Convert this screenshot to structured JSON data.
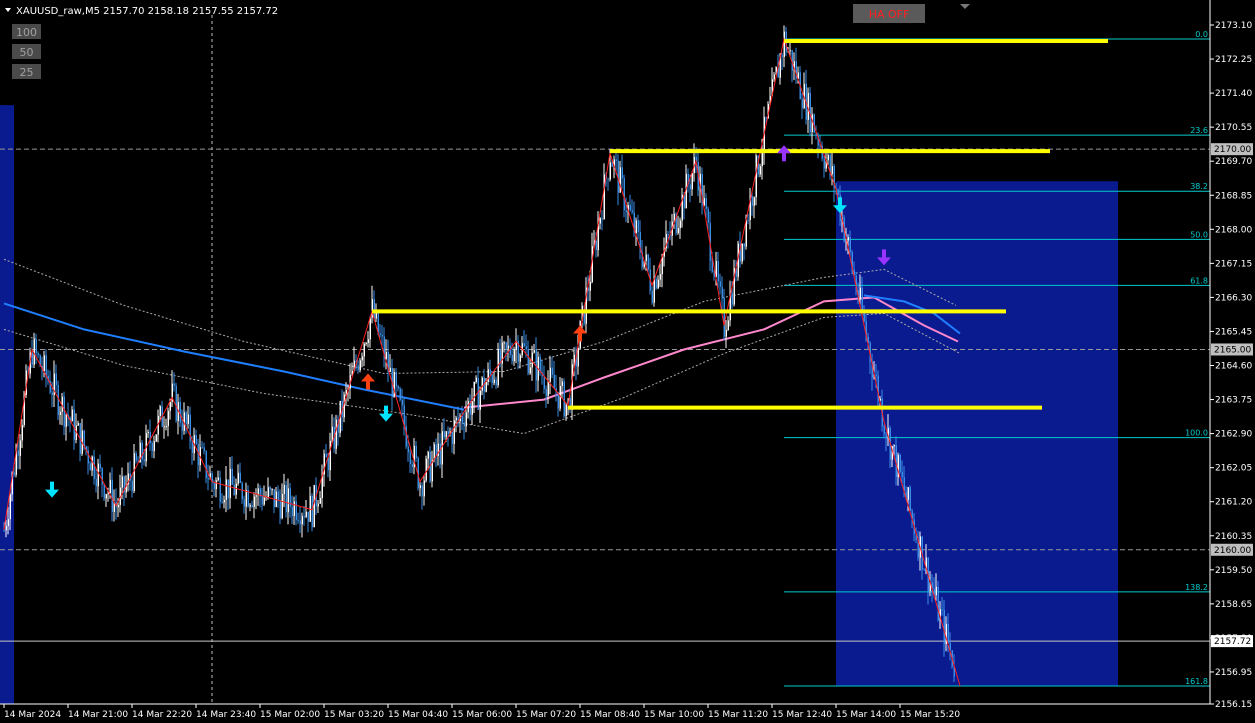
{
  "header": {
    "title": "XAUUSD_raw,M5  2157.70 2158.18 2157.55 2157.72"
  },
  "buttons": {
    "scale": [
      "100",
      "50",
      "25"
    ],
    "ha_toggle": "HA OFF"
  },
  "colors": {
    "background": "#000000",
    "bull_candle": "#ffffff",
    "bear_candle": "#3a8ee6",
    "zigzag": "#ff2020",
    "level": "#ffff00",
    "fib": "#00cccc",
    "ma_blue": "#1f7fff",
    "ma_pink": "#ff88cc",
    "arrow_up": "#ff4010",
    "arrow_down_cyan": "#00e5ff",
    "arrow_purple": "#9933ff",
    "box": "#0a1a8f",
    "price_tag_bg": "#ffffff"
  },
  "chart_data": {
    "type": "candlestick",
    "symbol": "XAUUSD_raw",
    "timeframe": "M5",
    "ohlc_current": {
      "open": 2157.7,
      "high": 2158.18,
      "low": 2157.55,
      "close": 2157.72
    },
    "ylim": [
      2156.15,
      2173.1
    ],
    "y_ticks": [
      "2173.10",
      "2172.25",
      "2171.40",
      "2170.55",
      "2169.70",
      "2168.85",
      "2168.00",
      "2167.15",
      "2166.30",
      "2165.45",
      "2164.60",
      "2163.75",
      "2162.90",
      "2162.05",
      "2161.20",
      "2160.35",
      "2159.50",
      "2158.65",
      "2157.80",
      "2156.95",
      "2156.15"
    ],
    "y_tick_values": [
      2173.1,
      2172.25,
      2171.4,
      2170.55,
      2169.7,
      2168.85,
      2168.0,
      2167.15,
      2166.3,
      2165.45,
      2164.6,
      2163.75,
      2162.9,
      2162.05,
      2161.2,
      2160.35,
      2159.5,
      2158.65,
      2157.8,
      2156.95,
      2156.15
    ],
    "x_ticks": [
      "14 Mar 2024",
      "14 Mar 21:00",
      "14 Mar 22:20",
      "14 Mar 23:40",
      "15 Mar 02:00",
      "15 Mar 03:20",
      "15 Mar 04:40",
      "15 Mar 06:00",
      "15 Mar 07:20",
      "15 Mar 08:40",
      "15 Mar 10:00",
      "15 Mar 11:20",
      "15 Mar 12:40",
      "15 Mar 14:00",
      "15 Mar 15:20"
    ],
    "x_tick_index": [
      0,
      32,
      64,
      96,
      128,
      160,
      192,
      224,
      256,
      288,
      320,
      352,
      384,
      416,
      448
    ],
    "bar_count": 476,
    "price_tags": [
      {
        "label": "2170.00",
        "value": 2170.0,
        "style": "gray"
      },
      {
        "label": "2165.00",
        "value": 2165.0,
        "style": "gray"
      },
      {
        "label": "2160.00",
        "value": 2160.0,
        "style": "gray"
      },
      {
        "label": "2157.72",
        "value": 2157.72,
        "style": "white"
      }
    ],
    "fib_levels": [
      {
        "label": "0.0",
        "value": 2172.75
      },
      {
        "label": "23.6",
        "value": 2170.35
      },
      {
        "label": "38.2",
        "value": 2168.95
      },
      {
        "label": "50.0",
        "value": 2167.75
      },
      {
        "label": "61.8",
        "value": 2166.6
      },
      {
        "label": "100.0",
        "value": 2162.8
      },
      {
        "label": "138.2",
        "value": 2158.95
      },
      {
        "label": "161.8",
        "value": 2156.6
      }
    ],
    "fib_start_index": 390,
    "horizontal_levels": [
      {
        "value": 2172.7,
        "from": 390,
        "to": 552
      },
      {
        "value": 2169.95,
        "from": 303,
        "to": 523
      },
      {
        "value": 2165.95,
        "from": 184,
        "to": 501
      },
      {
        "value": 2163.55,
        "from": 282,
        "to": 519
      }
    ],
    "box": {
      "from_index": 416,
      "to_index": 557,
      "top": 2169.2,
      "bottom": 2156.6
    },
    "left_box": {
      "from_index": 0,
      "to_index": 6,
      "top": 2171.1,
      "bottom": 2156.15
    },
    "vertical_dashed_index": 104,
    "zigzag": [
      [
        0,
        2160.5
      ],
      [
        14,
        2165.0
      ],
      [
        56,
        2161.1
      ],
      [
        84,
        2163.8
      ],
      [
        104,
        2161.7
      ],
      [
        154,
        2161.0
      ],
      [
        184,
        2165.95
      ],
      [
        208,
        2161.7
      ],
      [
        232,
        2163.6
      ],
      [
        256,
        2165.2
      ],
      [
        282,
        2163.6
      ],
      [
        303,
        2169.9
      ],
      [
        324,
        2166.6
      ],
      [
        346,
        2169.7
      ],
      [
        360,
        2165.6
      ],
      [
        390,
        2172.75
      ],
      [
        416,
        2169.0
      ],
      [
        440,
        2163.2
      ],
      [
        478,
        2156.6
      ]
    ],
    "arrows": [
      {
        "index": 24,
        "value": 2161.5,
        "dir": "down",
        "color": "cyan"
      },
      {
        "index": 182,
        "value": 2164.2,
        "dir": "up",
        "color": "red"
      },
      {
        "index": 191,
        "value": 2163.4,
        "dir": "down",
        "color": "cyan"
      },
      {
        "index": 288,
        "value": 2165.4,
        "dir": "up",
        "color": "red"
      },
      {
        "index": 390,
        "value": 2169.9,
        "dir": "up",
        "color": "purple"
      },
      {
        "index": 418,
        "value": 2168.6,
        "dir": "down",
        "color": "cyan"
      },
      {
        "index": 440,
        "value": 2167.3,
        "dir": "down",
        "color": "purple"
      }
    ]
  }
}
